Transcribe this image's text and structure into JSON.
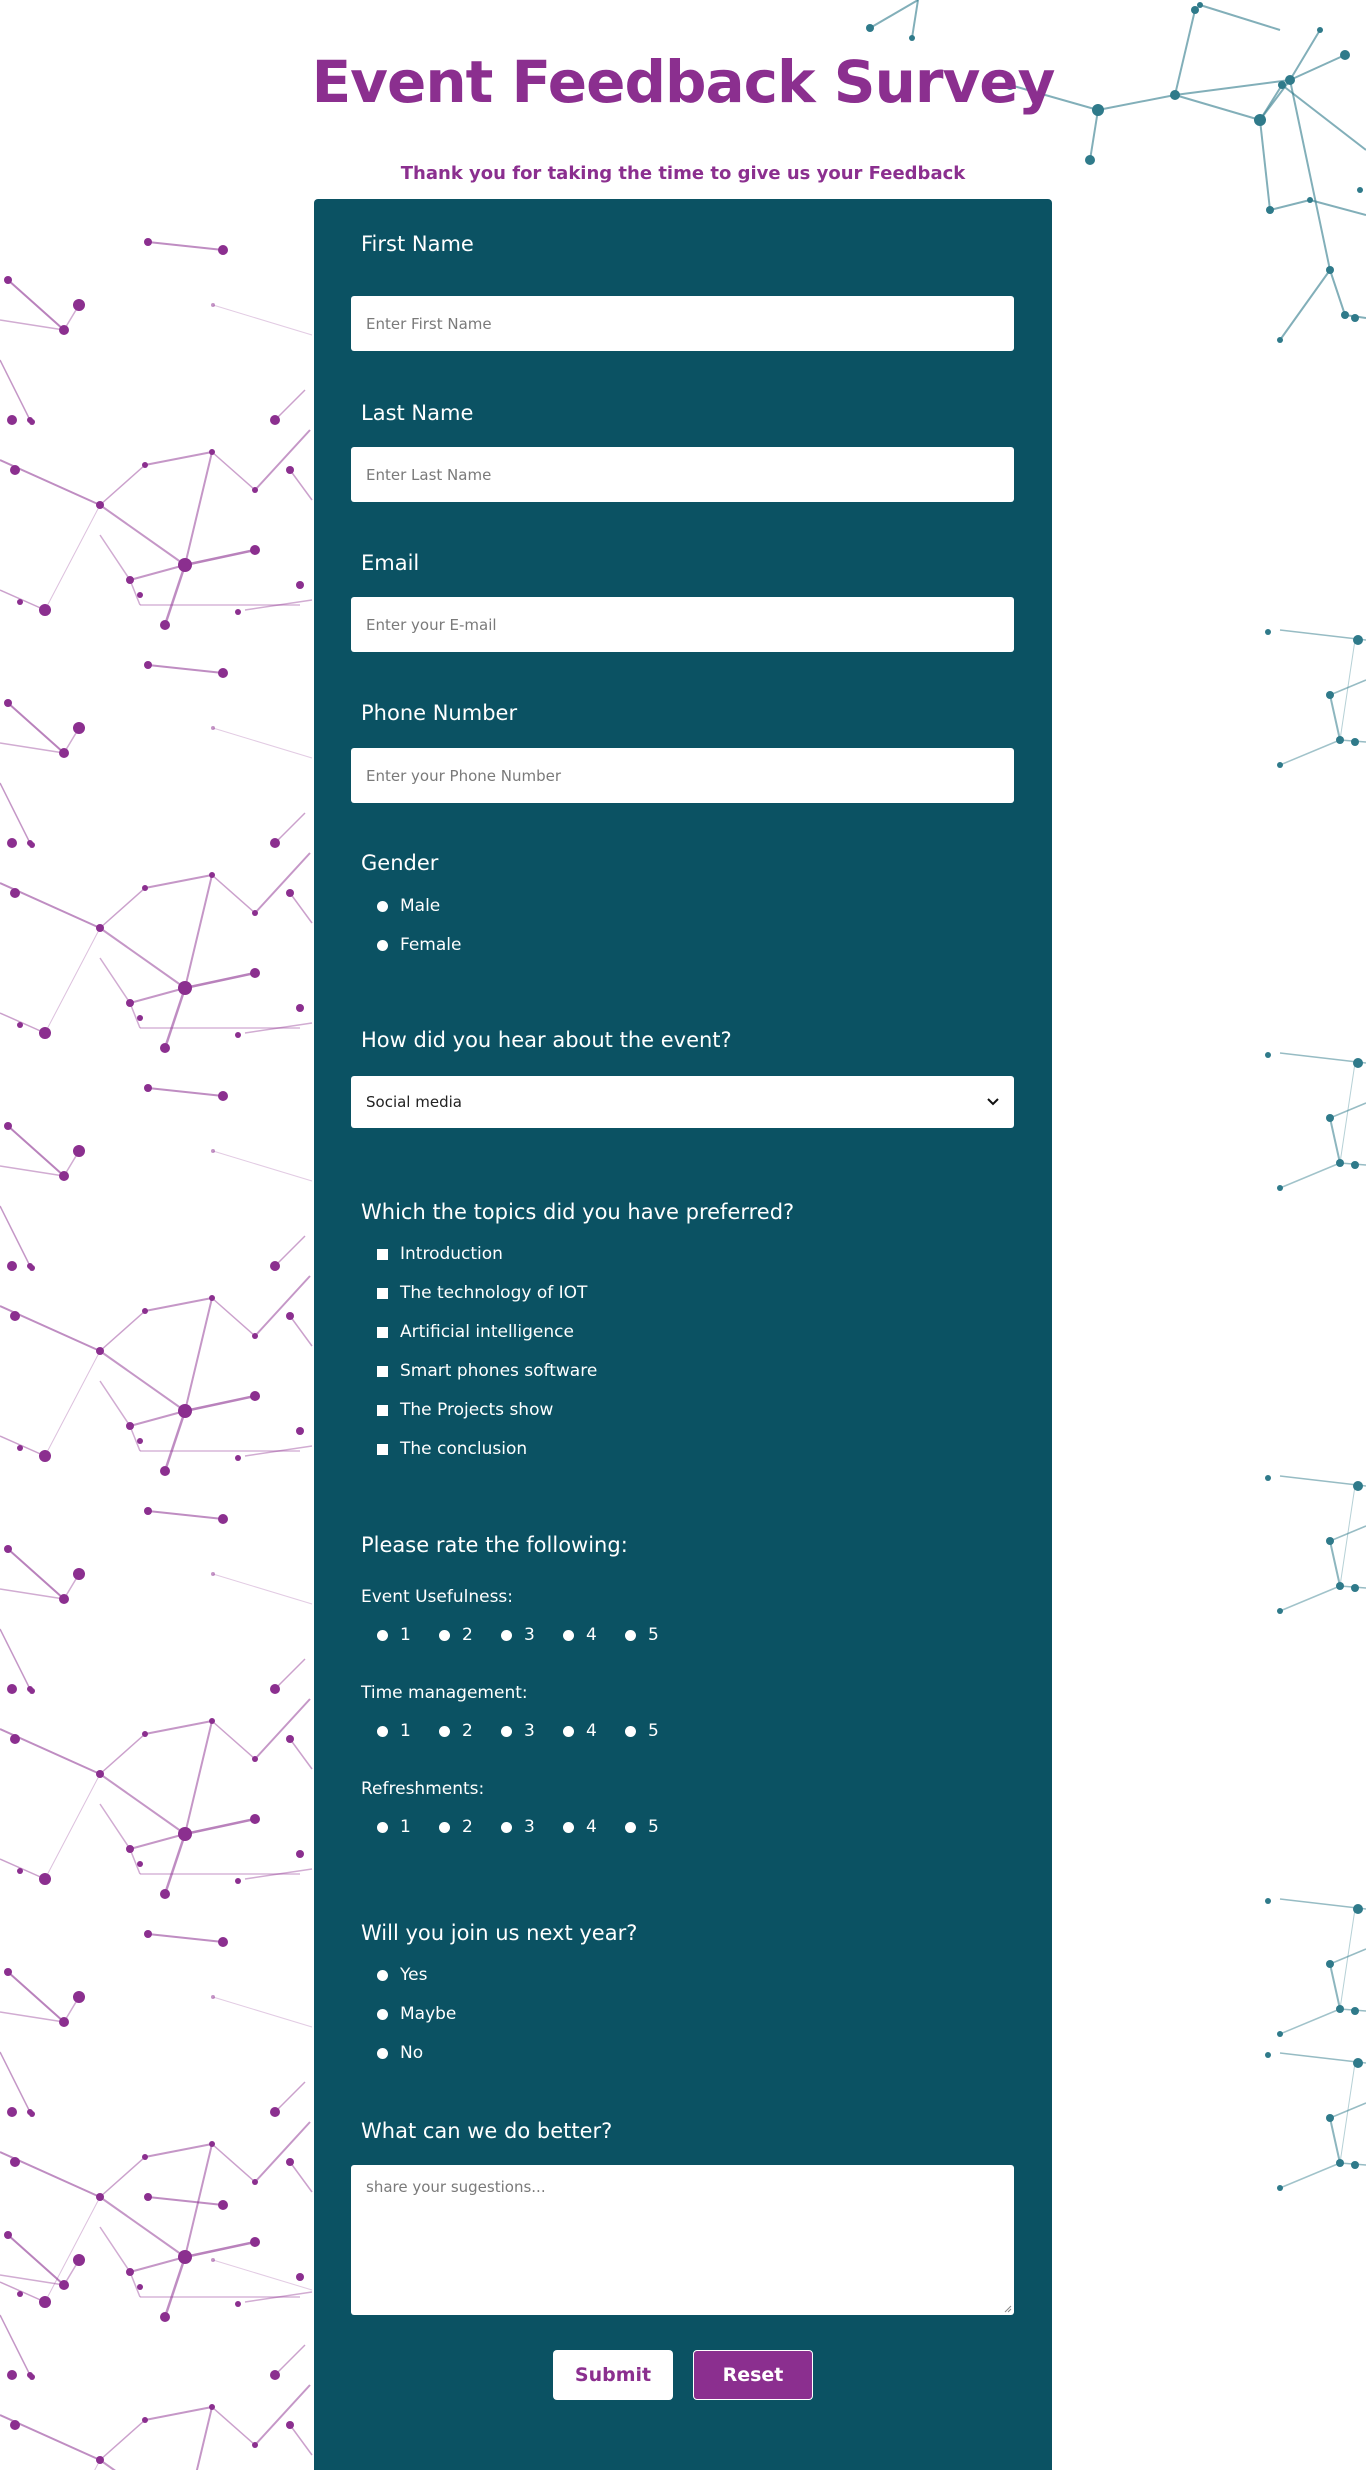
{
  "page": {
    "title": "Event Feedback Survey",
    "subtitle": "Thank you for taking the time to give us your Feedback"
  },
  "colors": {
    "brand_purple": "#8b2f8f",
    "form_background": "#0b5263",
    "network_teal": "#2f7a8a"
  },
  "fields": {
    "first_name": {
      "label": "First Name",
      "placeholder": "Enter First Name",
      "value": ""
    },
    "last_name": {
      "label": "Last Name",
      "placeholder": "Enter Last Name",
      "value": ""
    },
    "email": {
      "label": "Email",
      "placeholder": "Enter your E-mail",
      "value": ""
    },
    "phone": {
      "label": "Phone Number",
      "placeholder": "Enter your Phone Number",
      "value": ""
    }
  },
  "gender": {
    "label": "Gender",
    "options": [
      "Male",
      "Female"
    ]
  },
  "source": {
    "label": "How did you hear about the event?",
    "selected": "Social media"
  },
  "topics": {
    "label": "Which the topics did you have preferred?",
    "options": [
      "Introduction",
      "The technology of IOT",
      "Artificial intelligence",
      "Smart phones software",
      "The Projects show",
      "The conclusion"
    ]
  },
  "ratings": {
    "label": "Please rate the following:",
    "scale": [
      "1",
      "2",
      "3",
      "4",
      "5"
    ],
    "items": [
      {
        "label": "Event Usefulness:"
      },
      {
        "label": "Time management:"
      },
      {
        "label": "Refreshments:"
      }
    ]
  },
  "join_next_year": {
    "label": "Will you join us next year?",
    "options": [
      "Yes",
      "Maybe",
      "No"
    ]
  },
  "suggestions": {
    "label": "What can we do better?",
    "placeholder": "share your sugestions..."
  },
  "buttons": {
    "submit": "Submit",
    "reset": "Reset"
  }
}
